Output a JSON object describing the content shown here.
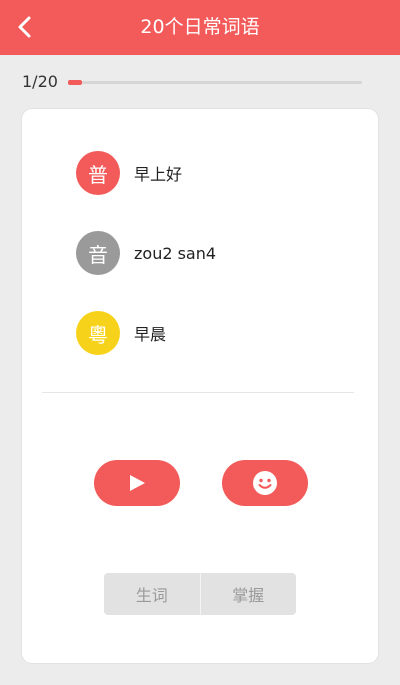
{
  "header": {
    "title": "20个日常词语",
    "back_icon": "chevron-left-icon"
  },
  "progress": {
    "text": "1/20",
    "current": 1,
    "total": 20
  },
  "entries": [
    {
      "badge": "普",
      "badge_color": "#f35a5a",
      "text": "早上好"
    },
    {
      "badge": "音",
      "badge_color": "#9a9a9a",
      "text": "zou2 san4"
    },
    {
      "badge": "粵",
      "badge_color": "#f7d21a",
      "text": "早晨"
    }
  ],
  "actions": {
    "play_icon": "play-icon",
    "smiley_icon": "smiley-icon"
  },
  "segmented": {
    "left_label": "生词",
    "right_label": "掌握"
  },
  "colors": {
    "accent": "#f35a5a",
    "background": "#ececec"
  }
}
